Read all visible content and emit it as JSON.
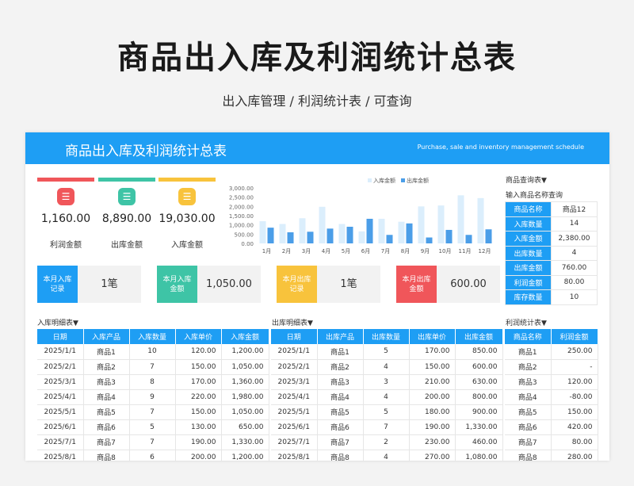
{
  "page": {
    "title": "商品出入库及利润统计总表",
    "subtitle": "出入库管理 / 利润统计表 / 可查询"
  },
  "banner": {
    "title": "商品出入库及利润统计总表",
    "subtitle": "Purchase, sale and inventory management schedule"
  },
  "kpis": [
    {
      "value": "1,160.00",
      "label": "利润金额",
      "color": "#f0565a",
      "icon": "database-icon"
    },
    {
      "value": "8,890.00",
      "label": "出库金额",
      "color": "#3ec4a6",
      "icon": "database-icon"
    },
    {
      "value": "19,030.00",
      "label": "入库金额",
      "color": "#f8c33c",
      "icon": "database-icon"
    }
  ],
  "cards": [
    {
      "tag": "本月入库记录",
      "value": "1笔",
      "color": "#1e9ef4"
    },
    {
      "tag": "本月入库金额",
      "value": "1,050.00",
      "color": "#3ec4a6"
    },
    {
      "tag": "本月出库记录",
      "value": "1笔",
      "color": "#f8c33c"
    },
    {
      "tag": "本月出库金额",
      "value": "600.00",
      "color": "#f0565a"
    }
  ],
  "chart_data": {
    "type": "bar",
    "categories": [
      "1月",
      "2月",
      "3月",
      "4月",
      "5月",
      "6月",
      "7月",
      "8月",
      "9月",
      "10月",
      "11月",
      "12月"
    ],
    "series": [
      {
        "name": "入库金额",
        "values": [
          1200,
          1050,
          1360,
          1980,
          1050,
          650,
          1330,
          1170,
          2000,
          2050,
          2600,
          2450
        ],
        "color": "#dbeefc"
      },
      {
        "name": "出库金额",
        "values": [
          850,
          600,
          630,
          800,
          900,
          1330,
          460,
          1080,
          320,
          730,
          460,
          760
        ],
        "color": "#4b9ee8"
      }
    ],
    "y_ticks": [
      "0.00",
      "500.00",
      "1,000.00",
      "1,500.00",
      "2,000.00",
      "2,500.00",
      "3,000.00"
    ],
    "ylim": [
      0,
      3000
    ],
    "legend": "top-center"
  },
  "query": {
    "title": "商品查询表▼",
    "subtitle": "输入商品名称查询",
    "rows": [
      {
        "k": "商品名称",
        "v": "商品12"
      },
      {
        "k": "入库数量",
        "v": "14"
      },
      {
        "k": "入库金额",
        "v": "2,380.00"
      },
      {
        "k": "出库数量",
        "v": "4"
      },
      {
        "k": "出库金额",
        "v": "760.00"
      },
      {
        "k": "利润金额",
        "v": "80.00"
      },
      {
        "k": "库存数量",
        "v": "10"
      }
    ]
  },
  "inbound": {
    "title": "入库明细表▼",
    "headers": [
      "日期",
      "入库产品",
      "入库数量",
      "入库单价",
      "入库金额"
    ],
    "rows": [
      [
        "2025/1/1",
        "商品1",
        "10",
        "120.00",
        "1,200.00"
      ],
      [
        "2025/2/1",
        "商品2",
        "7",
        "150.00",
        "1,050.00"
      ],
      [
        "2025/3/1",
        "商品3",
        "8",
        "170.00",
        "1,360.00"
      ],
      [
        "2025/4/1",
        "商品4",
        "9",
        "220.00",
        "1,980.00"
      ],
      [
        "2025/5/1",
        "商品5",
        "7",
        "150.00",
        "1,050.00"
      ],
      [
        "2025/6/1",
        "商品6",
        "5",
        "130.00",
        "650.00"
      ],
      [
        "2025/7/1",
        "商品7",
        "7",
        "190.00",
        "1,330.00"
      ],
      [
        "2025/8/1",
        "商品8",
        "6",
        "200.00",
        "1,200.00"
      ]
    ]
  },
  "outbound": {
    "title": "出库明细表▼",
    "headers": [
      "日期",
      "出库产品",
      "出库数量",
      "出库单价",
      "出库金额"
    ],
    "rows": [
      [
        "2025/1/1",
        "商品1",
        "5",
        "170.00",
        "850.00"
      ],
      [
        "2025/2/1",
        "商品2",
        "4",
        "150.00",
        "600.00"
      ],
      [
        "2025/3/1",
        "商品3",
        "3",
        "210.00",
        "630.00"
      ],
      [
        "2025/4/1",
        "商品4",
        "4",
        "200.00",
        "800.00"
      ],
      [
        "2025/5/1",
        "商品5",
        "5",
        "180.00",
        "900.00"
      ],
      [
        "2025/6/1",
        "商品6",
        "7",
        "190.00",
        "1,330.00"
      ],
      [
        "2025/7/1",
        "商品7",
        "2",
        "230.00",
        "460.00"
      ],
      [
        "2025/8/1",
        "商品8",
        "4",
        "270.00",
        "1,080.00"
      ]
    ]
  },
  "profit": {
    "title": "利润统计表▼",
    "headers": [
      "商品名称",
      "利润金额"
    ],
    "rows": [
      [
        "商品1",
        "250.00"
      ],
      [
        "商品2",
        "-"
      ],
      [
        "商品3",
        "120.00"
      ],
      [
        "商品4",
        "-80.00"
      ],
      [
        "商品5",
        "150.00"
      ],
      [
        "商品6",
        "420.00"
      ],
      [
        "商品7",
        "80.00"
      ],
      [
        "商品8",
        "280.00"
      ]
    ]
  }
}
